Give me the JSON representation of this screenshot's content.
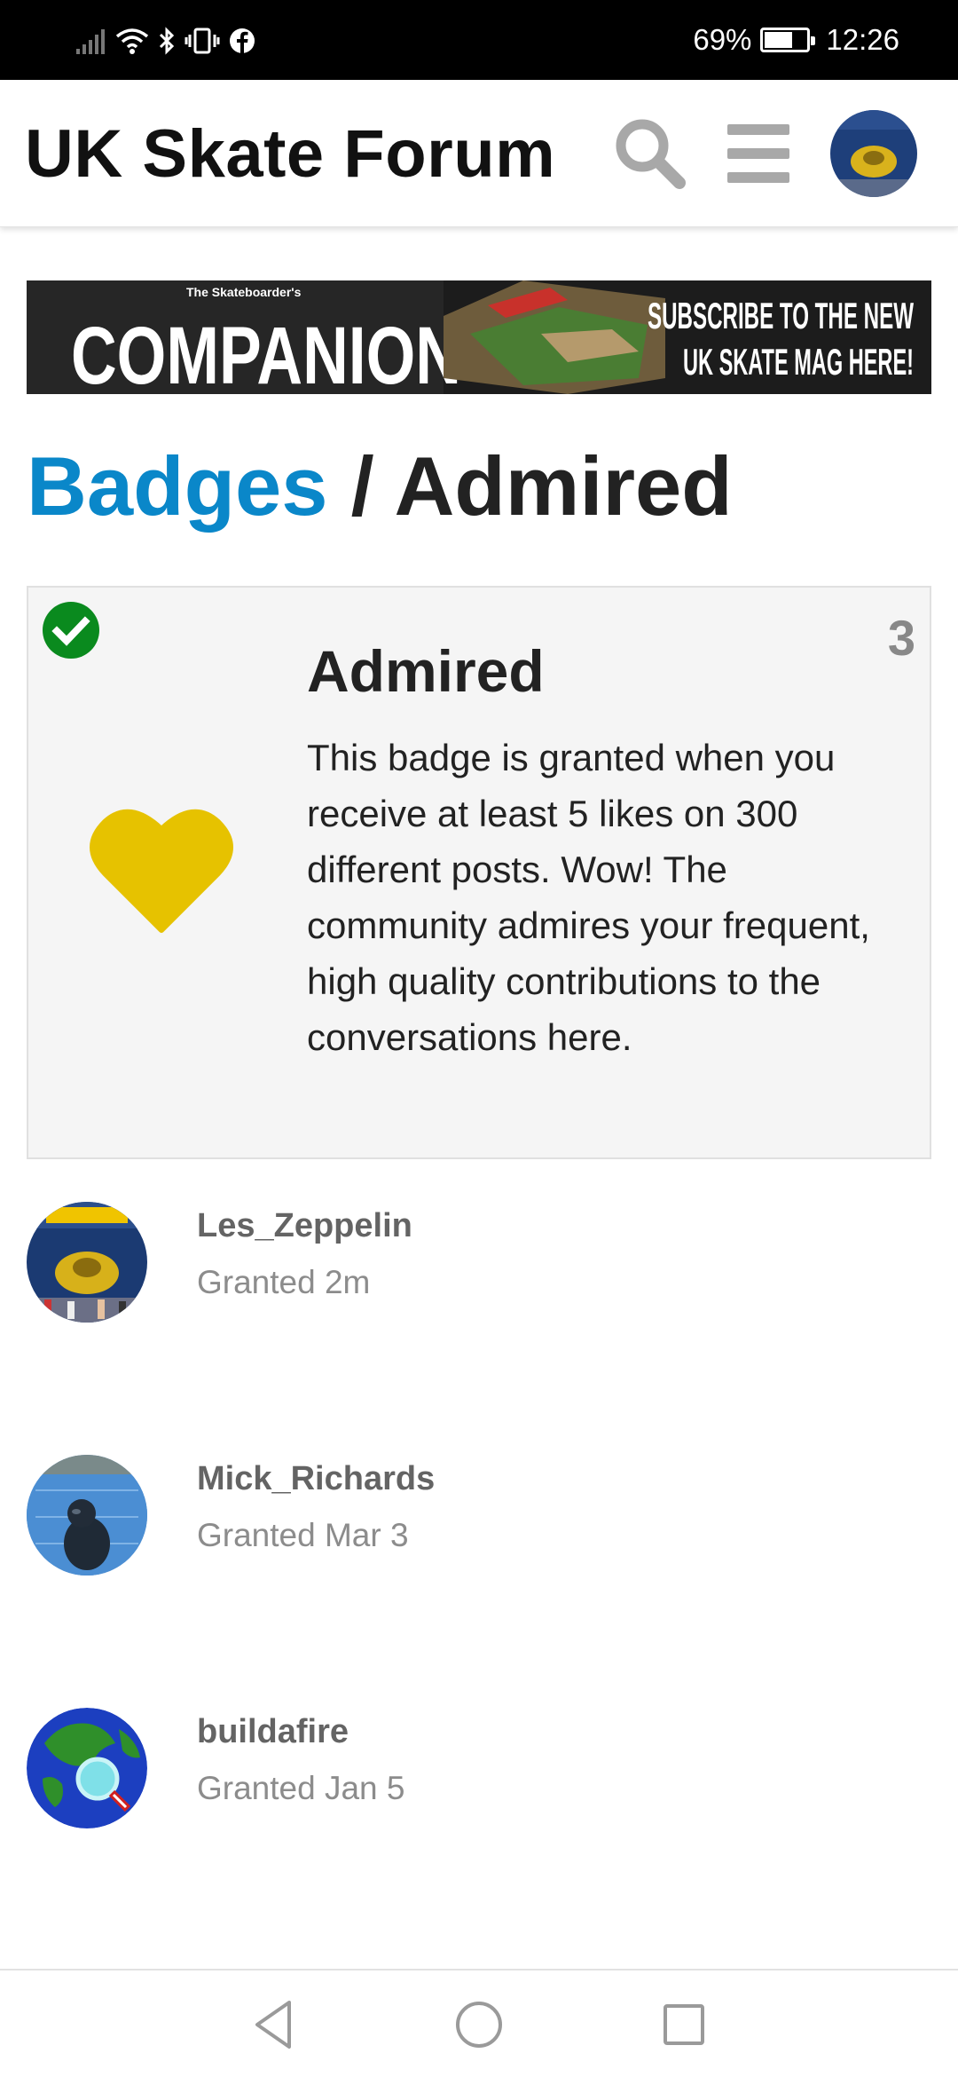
{
  "status_bar": {
    "battery": "69%",
    "battery_level": 0.69,
    "time": "12:26",
    "icons": [
      "signal-icon",
      "wifi-icon",
      "bluetooth-icon",
      "vibrate-icon",
      "facebook-icon",
      "battery-icon"
    ]
  },
  "header": {
    "site_title": "UK Skate Forum",
    "icons": [
      "search-icon",
      "hamburger-menu-icon",
      "user-avatar"
    ]
  },
  "banner": {
    "kicker": "The Skateboarder's",
    "title": "COMPANION",
    "cta_line1": "SUBSCRIBE TO THE NEW",
    "cta_line2": "UK SKATE MAG HERE!"
  },
  "breadcrumb": {
    "parent": "Badges",
    "separator": " / ",
    "current": "Admired"
  },
  "badge": {
    "title": "Admired",
    "count": "3",
    "description": "This badge is granted when you receive at least 5 likes on 300 different posts. Wow! The community admires your frequent, high quality contributions to the conversations here.",
    "granted_check_color": "#0a8a1e",
    "heart_color": "#e6c200",
    "icons": [
      "check-circle-icon",
      "heart-icon"
    ]
  },
  "users": [
    {
      "name": "Les_Zeppelin",
      "granted": "Granted 2m"
    },
    {
      "name": "Mick_Richards",
      "granted": "Granted Mar 3"
    },
    {
      "name": "buildafire",
      "granted": "Granted Jan 5"
    }
  ],
  "nav_bar": {
    "icons": [
      "back-icon",
      "home-icon",
      "recents-icon"
    ]
  },
  "colors": {
    "link": "#0a87c9",
    "title": "#222222",
    "username": "#646464",
    "muted": "#8c8c8c"
  }
}
